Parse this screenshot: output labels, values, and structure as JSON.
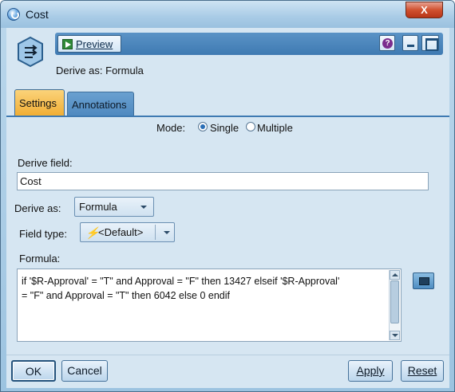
{
  "window": {
    "title": "Cost",
    "close_label": "X"
  },
  "toolbar": {
    "preview_label": "Preview",
    "help_label": "?"
  },
  "header": {
    "derive_as_text": "Derive as: Formula"
  },
  "tabs": [
    {
      "label": "Settings",
      "active": true
    },
    {
      "label": "Annotations",
      "active": false
    }
  ],
  "settings": {
    "mode_label": "Mode:",
    "mode_options": [
      "Single",
      "Multiple"
    ],
    "mode_selected": "Single",
    "derive_field_label": "Derive field:",
    "derive_field_value": "Cost",
    "derive_as_label": "Derive as:",
    "derive_as_value": "Formula",
    "field_type_label": "Field type:",
    "field_type_value": "<Default>",
    "formula_label": "Formula:",
    "formula_value": "if '$R-Approval' = \"T\" and Approval = \"F\" then 13427 elseif '$R-Approval'\n= \"F\" and Approval = \"T\" then 6042 else 0 endif"
  },
  "footer": {
    "ok_label": "OK",
    "cancel_label": "Cancel",
    "apply_label": "Apply",
    "reset_label": "Reset"
  },
  "colors": {
    "accent_tab": "#f0ad33",
    "toolbar_blue": "#3f7ab2",
    "panel_bg": "#d6e6f2",
    "close_red": "#d0512f"
  },
  "icons": [
    "app-icon",
    "derive-node-icon",
    "play-icon",
    "help-icon",
    "minimize-icon",
    "maximize-icon",
    "field-type-icon",
    "calculator-icon"
  ]
}
